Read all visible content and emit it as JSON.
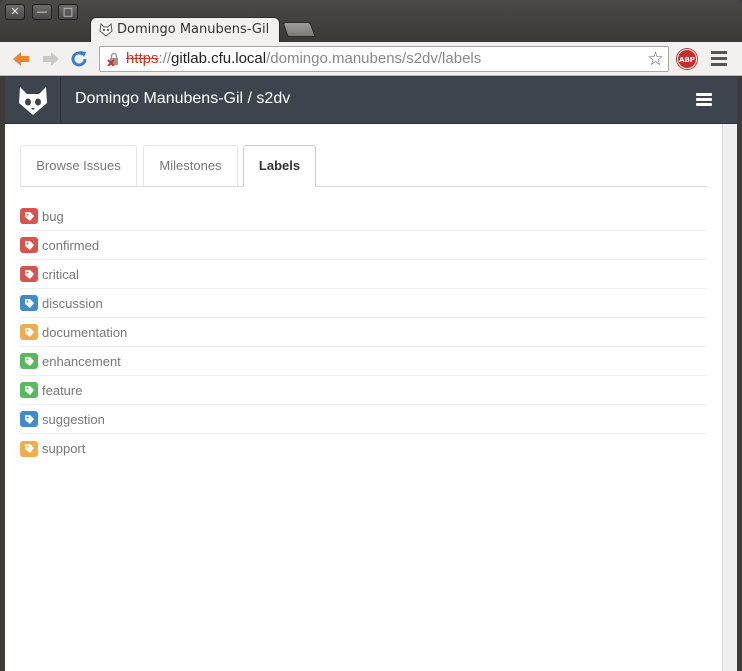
{
  "window": {
    "buttons": {
      "close": "✕",
      "minimize": "—",
      "maximize": "□"
    },
    "tab_title": "Domingo Manubens-Gil",
    "new_tab": ""
  },
  "toolbar": {
    "url_scheme": "https",
    "url_separator": "://",
    "url_host": "gitlab.cfu.local",
    "url_path": "/domingo.manubens/s2dv/labels",
    "abp_label": "ABP",
    "back_icon": "arrow-left-icon",
    "forward_icon": "arrow-right-icon",
    "reload_icon": "reload-icon",
    "star_icon": "star-icon"
  },
  "app": {
    "title": "Domingo Manubens-Gil / s2dv"
  },
  "tabs": [
    {
      "label": "Browse Issues",
      "active": false
    },
    {
      "label": "Milestones",
      "active": false
    },
    {
      "label": "Labels",
      "active": true
    }
  ],
  "labels": [
    {
      "name": "bug",
      "color": "#d9534f"
    },
    {
      "name": "confirmed",
      "color": "#d9534f"
    },
    {
      "name": "critical",
      "color": "#d9534f"
    },
    {
      "name": "discussion",
      "color": "#428bca"
    },
    {
      "name": "documentation",
      "color": "#f0ad4e"
    },
    {
      "name": "enhancement",
      "color": "#5cb85c"
    },
    {
      "name": "feature",
      "color": "#5cb85c"
    },
    {
      "name": "suggestion",
      "color": "#428bca"
    },
    {
      "name": "support",
      "color": "#f0ad4e"
    }
  ]
}
